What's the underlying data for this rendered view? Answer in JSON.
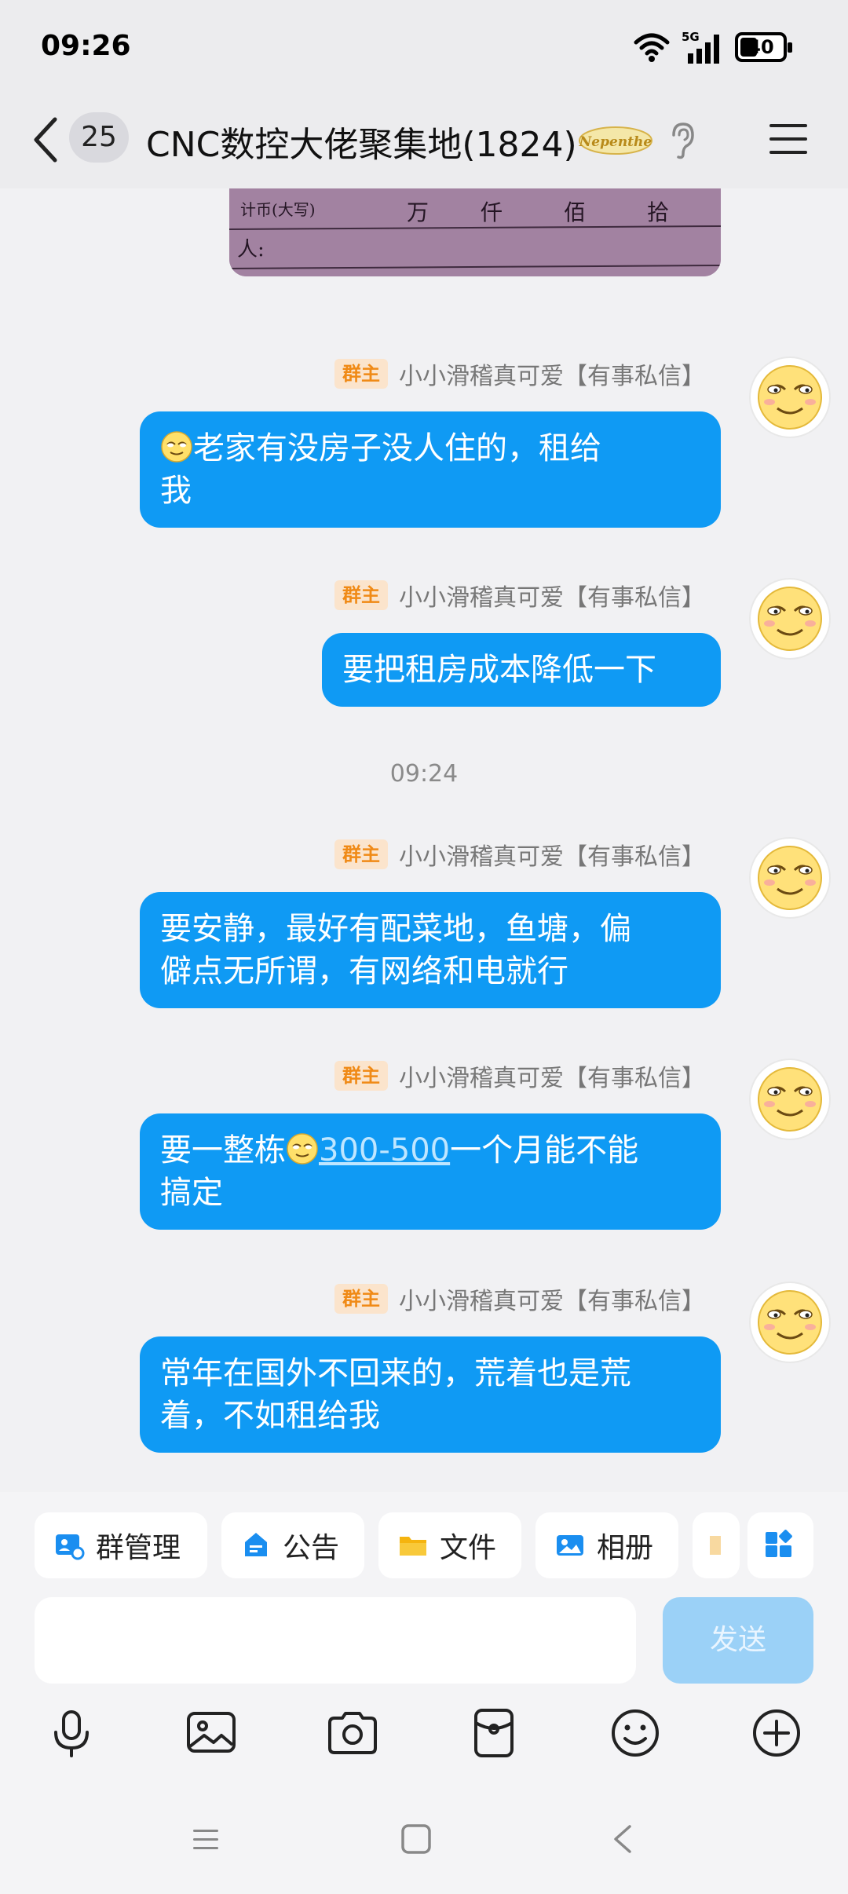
{
  "status_bar": {
    "time": "09:26",
    "network": "5G",
    "battery": "40"
  },
  "header": {
    "unread_count": "25",
    "title": "CNC数控大佬聚集地(1824)",
    "badge_text": "Nepenthe"
  },
  "image_message": {
    "text_lines": [
      "计币(大写)",
      "万",
      "仟",
      "佰",
      "拾",
      "人:"
    ]
  },
  "messages": [
    {
      "role": "群主",
      "sender": "小小滑稽真可爱【有事私信】",
      "text_after_emoji": "老家有没房子没人住的，租给我",
      "line1": "老家有没房子没人住的，租给",
      "line2": "我"
    },
    {
      "role": "群主",
      "sender": "小小滑稽真可爱【有事私信】",
      "line1": "要把租房成本降低一下"
    },
    {
      "role": "群主",
      "sender": "小小滑稽真可爱【有事私信】",
      "line1": "要安静，最好有配菜地，鱼塘，偏",
      "line2": "僻点无所谓，有网络和电就行"
    },
    {
      "role": "群主",
      "sender": "小小滑稽真可爱【有事私信】",
      "line1_a": "要一整栋",
      "line1_link": "300-500",
      "line1_b": "一个月能不能",
      "line2": "搞定"
    },
    {
      "role": "群主",
      "sender": "小小滑稽真可爱【有事私信】",
      "line1": "常年在国外不回来的，荒着也是荒",
      "line2": "着，不如租给我"
    }
  ],
  "time_divider": "09:24",
  "toolbar": {
    "chips": [
      "群管理",
      "公告",
      "文件",
      "相册"
    ],
    "send_label": "发送",
    "input_value": ""
  },
  "icons": {
    "back": "chevron-left-icon",
    "ear": "ear-icon",
    "menu": "hamburger-menu-icon",
    "mic": "microphone-icon",
    "image": "image-icon",
    "camera": "camera-icon",
    "red_packet": "red-packet-icon",
    "emoji": "emoji-icon",
    "plus": "plus-circle-icon"
  },
  "colors": {
    "bubble": "#0f9af4",
    "role_tag_bg": "#fbe4cc",
    "role_tag_text": "#f08a16",
    "send_disabled": "#9bd1f7"
  }
}
